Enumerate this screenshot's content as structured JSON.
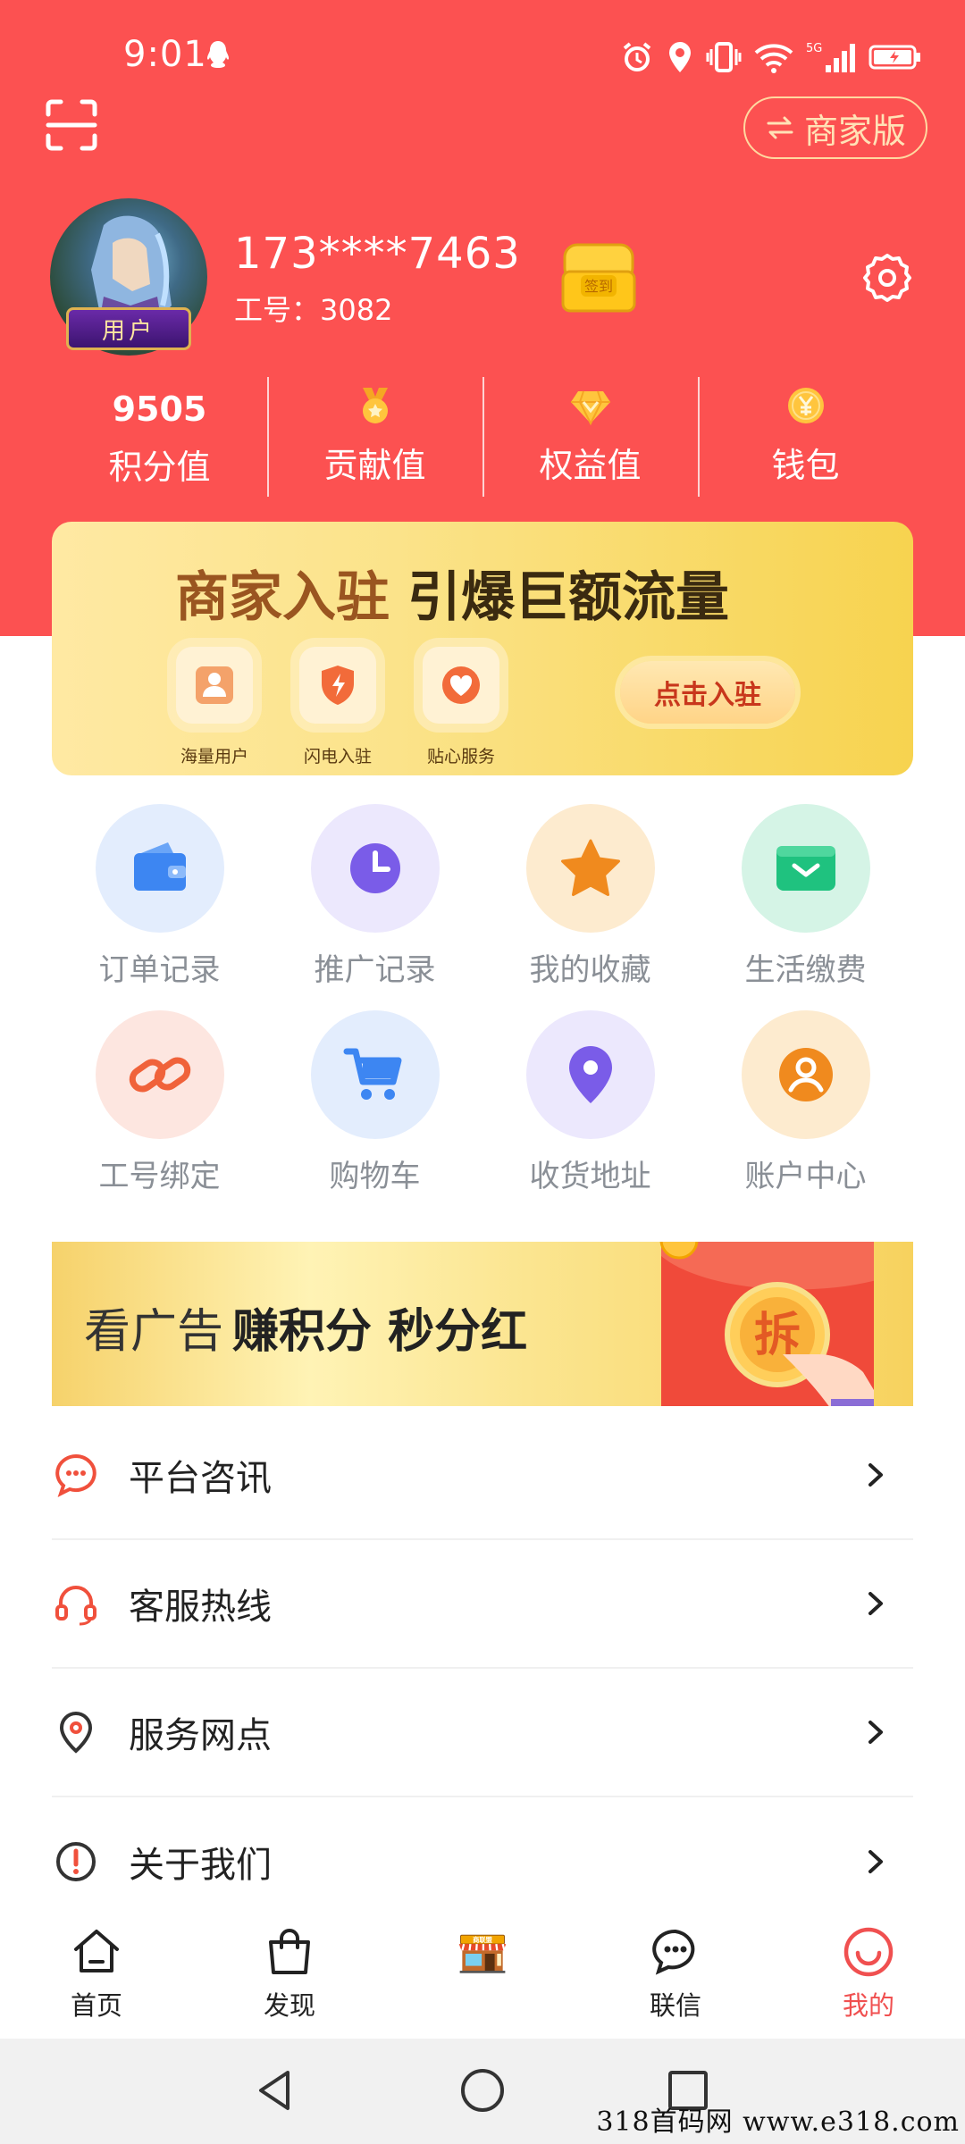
{
  "status_bar": {
    "time": "9:01",
    "network": "5G"
  },
  "header": {
    "merchant_switch_label": "商家版"
  },
  "profile": {
    "badge": "用户",
    "phone": "173****7463",
    "employee_no": "工号：3082",
    "signin_chest_text": "签到"
  },
  "stats": [
    {
      "value": "9505",
      "label": "积分值"
    },
    {
      "icon": "medal-icon",
      "label": "贡献值"
    },
    {
      "icon": "diamond-icon",
      "label": "权益值"
    },
    {
      "icon": "yuan-coin-icon",
      "label": "钱包"
    }
  ],
  "merchant_banner": {
    "title_part1": "商家入驻",
    "title_part2": "引爆巨额流量",
    "features": [
      "海量用户",
      "闪电入驻",
      "贴心服务"
    ],
    "cta": "点击入驻"
  },
  "grid": [
    {
      "label": "订单记录",
      "icon": "wallet-icon",
      "bg": "#e3edfd",
      "fg": "#3d86f2"
    },
    {
      "label": "推广记录",
      "icon": "clock-icon",
      "bg": "#ece8fd",
      "fg": "#7a5ce8"
    },
    {
      "label": "我的收藏",
      "icon": "star-icon",
      "bg": "#fdebcf",
      "fg": "#f08a1e"
    },
    {
      "label": "生活缴费",
      "icon": "envelope-icon",
      "bg": "#d5f4e6",
      "fg": "#1fc27f"
    },
    {
      "label": "工号绑定",
      "icon": "link-icon",
      "bg": "#fde6e0",
      "fg": "#f0623a"
    },
    {
      "label": "购物车",
      "icon": "cart-icon",
      "bg": "#e3edfd",
      "fg": "#3d86f2"
    },
    {
      "label": "收货地址",
      "icon": "location-pin-icon",
      "bg": "#ece8fd",
      "fg": "#7a5ce8"
    },
    {
      "label": "账户中心",
      "icon": "user-circle-icon",
      "bg": "#fdebcf",
      "fg": "#f08a1e"
    }
  ],
  "ad_banner": {
    "text_plain": "看广告",
    "text_bold": "赚积分 秒分红",
    "envelope_char": "拆"
  },
  "menu": [
    {
      "label": "平台咨讯",
      "icon": "chat-bubble-icon"
    },
    {
      "label": "客服热线",
      "icon": "headset-icon"
    },
    {
      "label": "服务网点",
      "icon": "location-icon"
    },
    {
      "label": "关于我们",
      "icon": "info-icon"
    }
  ],
  "tabbar": [
    {
      "label": "首页",
      "icon": "home-icon"
    },
    {
      "label": "发现",
      "icon": "shopping-bag-icon"
    },
    {
      "label": "",
      "icon": "store-icon",
      "store_sign": "商联盟"
    },
    {
      "label": "联信",
      "icon": "message-icon"
    },
    {
      "label": "我的",
      "icon": "smile-icon",
      "active": true
    }
  ],
  "watermark": "318首码网  www.e318.com",
  "colors": {
    "brand_red": "#fc5151",
    "active_tab": "#f05050"
  }
}
